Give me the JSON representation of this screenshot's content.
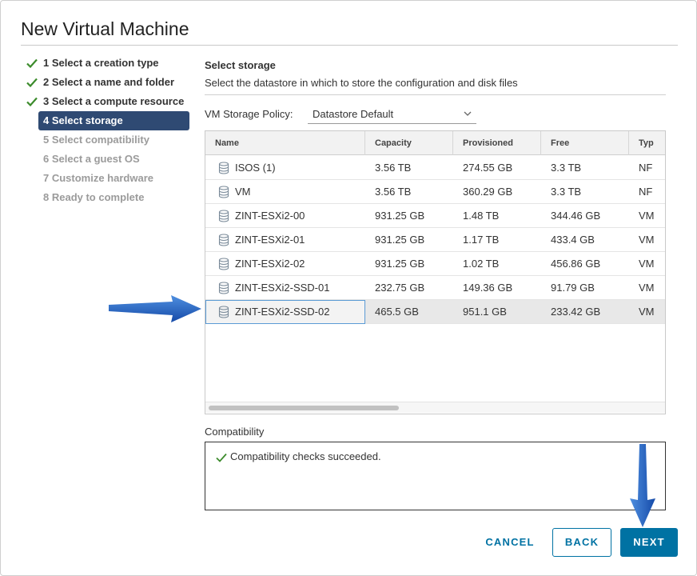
{
  "dialog": {
    "title": "New Virtual Machine"
  },
  "steps": [
    {
      "label": "1 Select a creation type",
      "state": "done"
    },
    {
      "label": "2 Select a name and folder",
      "state": "done"
    },
    {
      "label": "3 Select a compute resource",
      "state": "done"
    },
    {
      "label": "4 Select storage",
      "state": "active"
    },
    {
      "label": "5 Select compatibility",
      "state": "pending"
    },
    {
      "label": "6 Select a guest OS",
      "state": "pending"
    },
    {
      "label": "7 Customize hardware",
      "state": "pending"
    },
    {
      "label": "8 Ready to complete",
      "state": "pending"
    }
  ],
  "content": {
    "title": "Select storage",
    "description": "Select the datastore in which to store the configuration and disk files",
    "policy_label": "VM Storage Policy:",
    "policy_value": "Datastore Default"
  },
  "table": {
    "columns": [
      "Name",
      "Capacity",
      "Provisioned",
      "Free",
      "Typ"
    ],
    "rows": [
      {
        "name": "ISOS (1)",
        "capacity": "3.56 TB",
        "provisioned": "274.55 GB",
        "free": "3.3 TB",
        "type": "NF"
      },
      {
        "name": "VM",
        "capacity": "3.56 TB",
        "provisioned": "360.29 GB",
        "free": "3.3 TB",
        "type": "NF"
      },
      {
        "name": "ZINT-ESXi2-00",
        "capacity": "931.25 GB",
        "provisioned": "1.48 TB",
        "free": "344.46 GB",
        "type": "VM"
      },
      {
        "name": "ZINT-ESXi2-01",
        "capacity": "931.25 GB",
        "provisioned": "1.17 TB",
        "free": "433.4 GB",
        "type": "VM"
      },
      {
        "name": "ZINT-ESXi2-02",
        "capacity": "931.25 GB",
        "provisioned": "1.02 TB",
        "free": "456.86 GB",
        "type": "VM"
      },
      {
        "name": "ZINT-ESXi2-SSD-01",
        "capacity": "232.75 GB",
        "provisioned": "149.36 GB",
        "free": "91.79 GB",
        "type": "VM"
      },
      {
        "name": "ZINT-ESXi2-SSD-02",
        "capacity": "465.5 GB",
        "provisioned": "951.1 GB",
        "free": "233.42 GB",
        "type": "VM"
      }
    ],
    "selected_index": 6
  },
  "compatibility": {
    "label": "Compatibility",
    "message": "Compatibility checks succeeded."
  },
  "buttons": {
    "cancel": "CANCEL",
    "back": "BACK",
    "next": "NEXT"
  },
  "colors": {
    "accent": "#0072a3",
    "active_step": "#2f4a73",
    "check_green": "#3c8b2c",
    "annotation_arrow": "#1f5fbf"
  },
  "icons": {
    "done_step": "checkmark-icon",
    "datastore": "database-icon",
    "dropdown": "chevron-down-icon"
  }
}
